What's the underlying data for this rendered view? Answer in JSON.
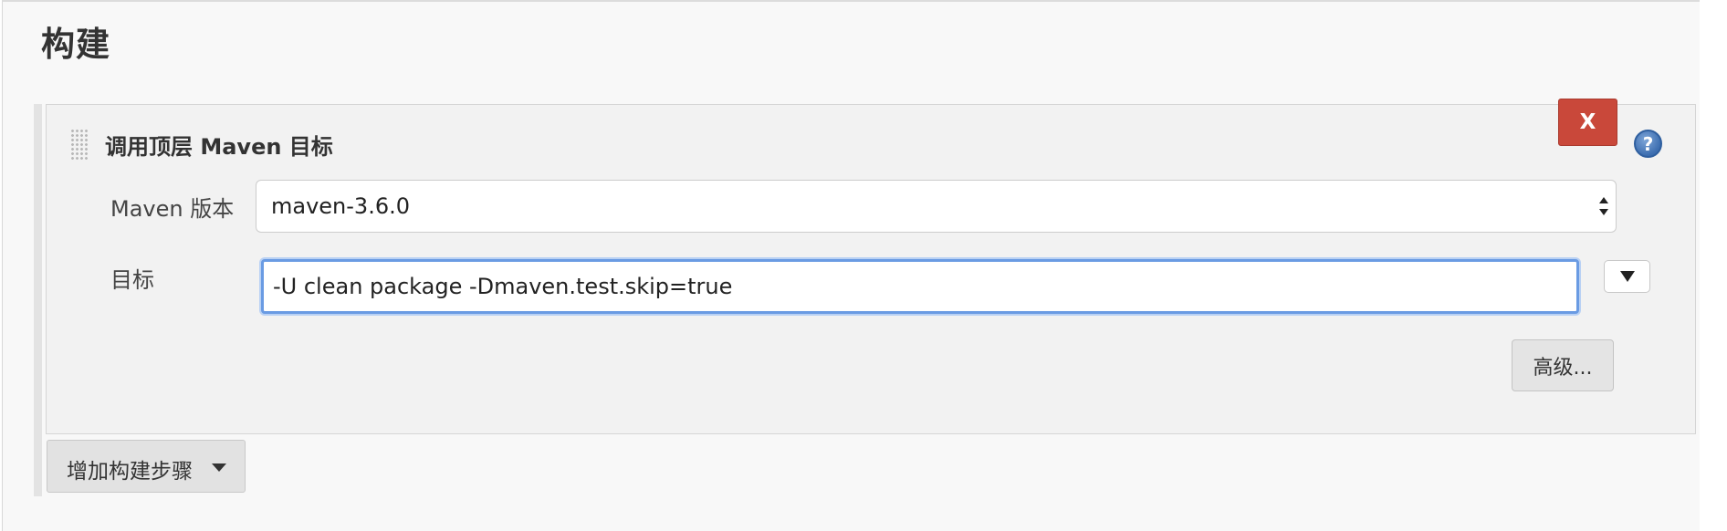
{
  "section": {
    "title": "构建"
  },
  "step": {
    "title": "调用顶层 Maven 目标",
    "delete_label": "X",
    "help_label": "?",
    "maven_version": {
      "label": "Maven 版本",
      "value": "maven-3.6.0"
    },
    "goals": {
      "label": "目标",
      "value": "-U clean package -Dmaven.test.skip=true"
    },
    "advanced_label": "高级..."
  },
  "add_step": {
    "label": "增加构建步骤"
  },
  "colors": {
    "delete_button": "#c9483a",
    "help_icon": "#3d6eb0",
    "input_focus_border": "#6a9be3"
  },
  "icons": [
    "drag-handle-icon",
    "help-icon",
    "select-arrows-icon",
    "expand-down-icon",
    "caret-down-icon"
  ]
}
